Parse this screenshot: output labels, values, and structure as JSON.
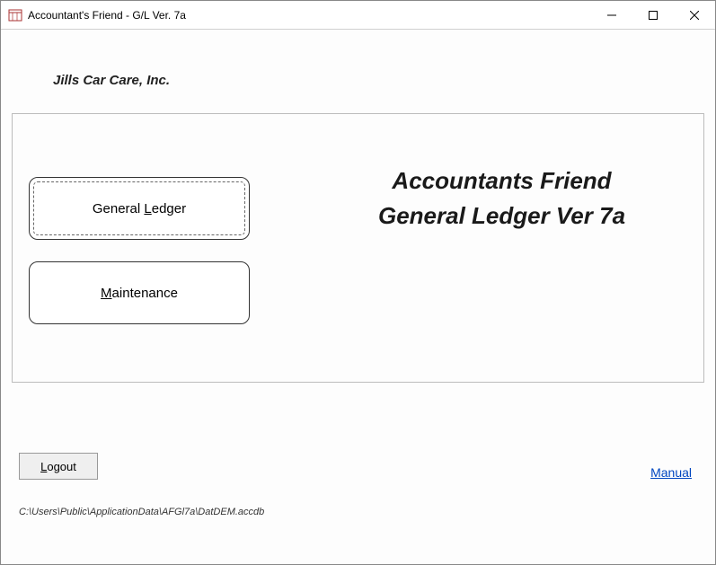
{
  "window": {
    "title": "Accountant's Friend -  G/L Ver. 7a"
  },
  "company": {
    "name": "Jills  Car Care, Inc."
  },
  "nav": {
    "general_ledger_pre": "General ",
    "general_ledger_key": "L",
    "general_ledger_post": "edger",
    "maintenance_key": "M",
    "maintenance_post": "aintenance"
  },
  "headline": {
    "line1": "Accountants Friend",
    "line2": "General Ledger   Ver 7a"
  },
  "footer": {
    "logout_key": "L",
    "logout_post": "ogout",
    "manual_label": "Manual"
  },
  "db_path": "C:\\Users\\Public\\ApplicationData\\AFGl7a\\DatDEM.accdb"
}
